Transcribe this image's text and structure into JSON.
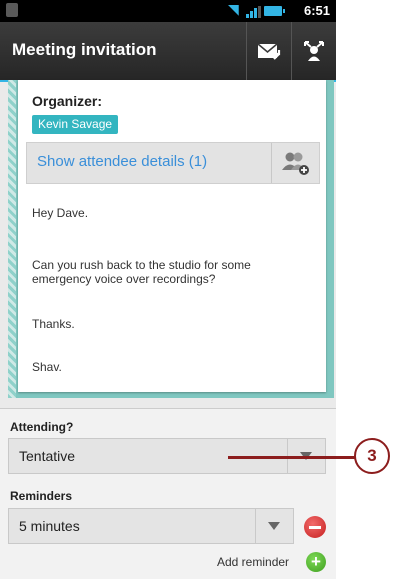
{
  "status_bar": {
    "time": "6:51"
  },
  "action_bar": {
    "title": "Meeting invitation",
    "actions": [
      {
        "icon": "reply-mail-icon"
      },
      {
        "icon": "forward-people-icon"
      }
    ]
  },
  "card": {
    "organizer_label": "Organizer:",
    "organizer_name": "Kevin Savage",
    "attendee_details": "Show attendee details (1)",
    "attendee_icon": "add-person-icon",
    "message_lines": [
      "Hey Dave.",
      "Can you rush back to the studio for some",
      "emergency voice over recordings?",
      "Thanks.",
      "Shav."
    ]
  },
  "attending": {
    "label": "Attending?",
    "selected": "Tentative"
  },
  "reminders": {
    "label": "Reminders",
    "selected": "5 minutes",
    "add_label": "Add reminder"
  },
  "callout": {
    "number": "3"
  },
  "colors": {
    "accent": "#33b5e5",
    "organizer_chip": "#33b5c0",
    "link_text": "#3a8fd9",
    "remove": "#c51f1f",
    "add": "#3f9f1f",
    "callout": "#8c1d1d"
  }
}
